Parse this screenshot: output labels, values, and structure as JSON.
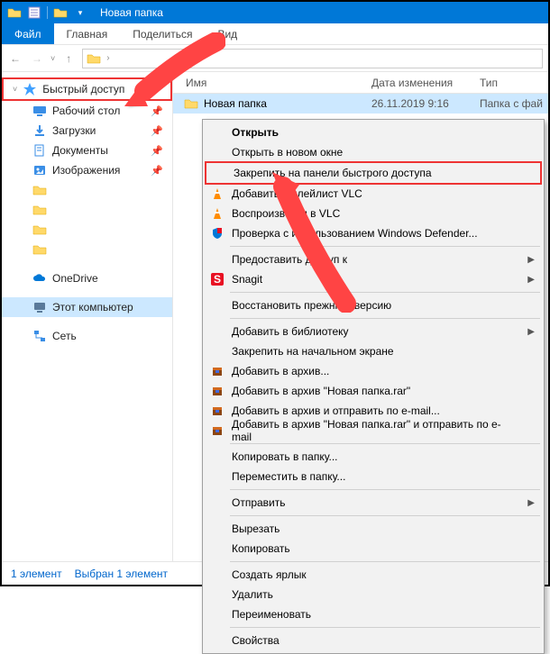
{
  "title": "Новая папка",
  "ribbon": {
    "file": "Файл",
    "tabs": [
      "Главная",
      "Поделиться",
      "Вид"
    ]
  },
  "sidebar": {
    "quick_access": "Быстрый доступ",
    "items": [
      {
        "label": "Рабочий стол",
        "icon": "desktop"
      },
      {
        "label": "Загрузки",
        "icon": "downloads"
      },
      {
        "label": "Документы",
        "icon": "documents"
      },
      {
        "label": "Изображения",
        "icon": "pictures"
      }
    ],
    "onedrive": "OneDrive",
    "this_pc": "Этот компьютер",
    "network": "Сеть"
  },
  "columns": {
    "name": "Имя",
    "date": "Дата изменения",
    "type": "Тип"
  },
  "row": {
    "name": "Новая папка",
    "date": "26.11.2019 9:16",
    "type": "Папка с фай"
  },
  "status": {
    "count": "1 элемент",
    "selected": "Выбран 1 элемент"
  },
  "ctx": {
    "open": "Открыть",
    "open_new": "Открыть в новом окне",
    "pin_qa": "Закрепить на панели быстрого доступа",
    "vlc": "Добавить в плейлист VLC",
    "vlc_play": "Воспроизвести в VLC",
    "defender": "Проверка с использованием Windows Defender...",
    "share": "Предоставить доступ к",
    "snagit": "Snagit",
    "restore": "Восстановить прежнюю версию",
    "library": "Добавить в библиотеку",
    "pin_start": "Закрепить на начальном экране",
    "rar_add": "Добавить в архив...",
    "rar_add_name": "Добавить в архив \"Новая папка.rar\"",
    "rar_email": "Добавить в архив и отправить по e-mail...",
    "rar_name_email": "Добавить в архив \"Новая папка.rar\" и отправить по e-mail",
    "copy_to": "Копировать в папку...",
    "move_to": "Переместить в папку...",
    "send_to": "Отправить",
    "cut": "Вырезать",
    "copy": "Копировать",
    "shortcut": "Создать ярлык",
    "delete": "Удалить",
    "rename": "Переименовать",
    "properties": "Свойства"
  }
}
